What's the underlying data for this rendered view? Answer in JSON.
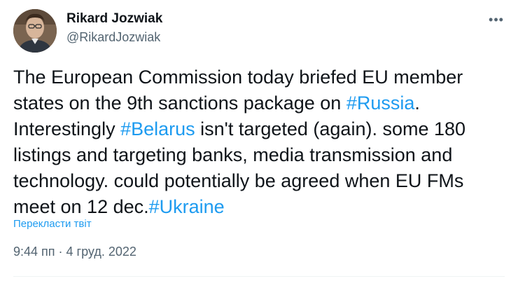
{
  "author": {
    "name": "Rikard Jozwiak",
    "handle": "@RikardJozwiak"
  },
  "menu": {
    "icon": "more-horizontal-icon"
  },
  "tweet": {
    "text_1": "The European Commission today briefed EU member states on the 9th sanctions package on ",
    "hashtag_1": "#Russia",
    "text_2": ". Interestingly ",
    "hashtag_2": "#Belarus",
    "text_3": " isn't targeted (again). some 180 listings and targeting banks, media transmission and technology. could potentially be agreed when EU FMs meet on 12 dec.",
    "hashtag_3": "#Ukraine"
  },
  "translate_label": "Перекласти твіт",
  "meta": {
    "time": "9:44 пп",
    "separator": "·",
    "date": "4 груд. 2022"
  },
  "colors": {
    "link": "#1d9bf0",
    "text": "#0f1419",
    "secondary": "#536471"
  }
}
